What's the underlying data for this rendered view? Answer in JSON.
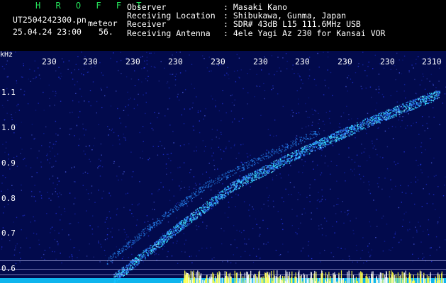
{
  "header": {
    "app_name": "H R O F F T",
    "filename": "UT2504242300.pn",
    "kind": "meteor",
    "datetime": "25.04.24 23:00",
    "count": "56.",
    "fields": [
      {
        "label": "Observer",
        "value": ": Masaki Kano"
      },
      {
        "label": "Receiving Location",
        "value": ": Shibukawa, Gunma, Japan"
      },
      {
        "label": "Receiver",
        "value": ": SDR# 43dB L15 111.6MHz USB"
      },
      {
        "label": "Receiving Antenna",
        "value": ": 4ele Yagi Az 230 for Kansai VOR"
      }
    ]
  },
  "spectrogram": {
    "unit_label": "kHz",
    "x_ticks": [
      "230",
      "230",
      "230",
      "230",
      "230",
      "230",
      "230",
      "230",
      "230",
      "2310"
    ],
    "y_ticks": [
      "1.1",
      "1.0",
      "0.9",
      "0.8",
      "0.7",
      "0.6"
    ],
    "colors": {
      "background": "#020a4c",
      "signal": "#36e8ff",
      "strong": "#ffff40",
      "grid": "#c8c8ff"
    }
  }
}
